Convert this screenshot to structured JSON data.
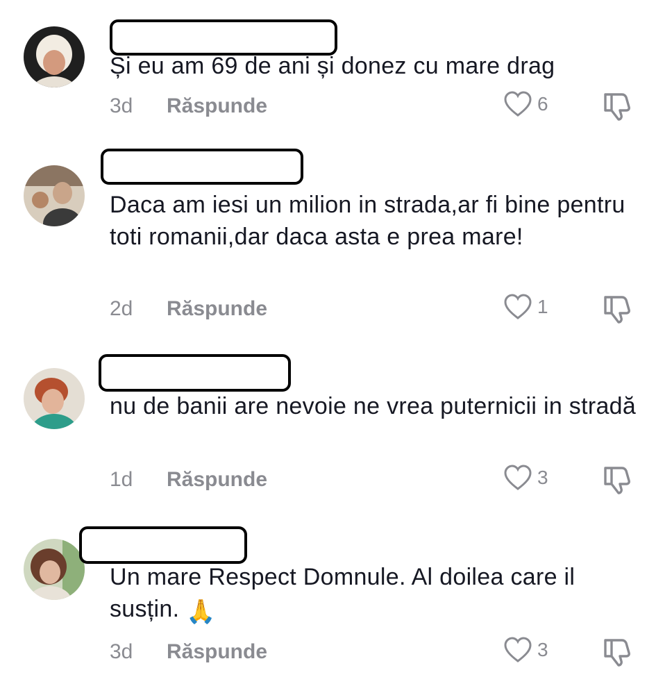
{
  "comments": [
    {
      "text": "Și eu am 69 de ani și donez cu mare drag",
      "time": "3d",
      "reply_label": "Răspunde",
      "likes": "6",
      "avatar_colors": [
        "#2a2a2a",
        "#f0e7d8",
        "#c28b6c"
      ]
    },
    {
      "text": "Daca am iesi un milion in strada,ar fi bine pentru toti romanii,dar daca asta e prea mare!",
      "time": "2d",
      "reply_label": "Răspunde",
      "likes": "1",
      "avatar_colors": [
        "#6b5a4a",
        "#d9c7ae",
        "#3a3a3a"
      ]
    },
    {
      "text": "nu de banii are nevoie ne vrea puternicii in stradă",
      "time": "1d",
      "reply_label": "Răspunde",
      "likes": "3",
      "avatar_colors": [
        "#d7d2c9",
        "#c0573b",
        "#2d9d8a"
      ]
    },
    {
      "text": "Un mare Respect Domnule. Al doilea care il susțin. ",
      "emoji": "🙏",
      "time": "3d",
      "reply_label": "Răspunde",
      "likes": "3",
      "avatar_colors": [
        "#6a4a3a",
        "#9fb98a",
        "#e0c8b6"
      ]
    }
  ],
  "colors": {
    "text": "#161823",
    "muted": "#8a8b91",
    "icon": "#8a8b91"
  },
  "icons": {
    "like": "heart-outline-icon",
    "dislike": "thumbs-down-icon"
  }
}
